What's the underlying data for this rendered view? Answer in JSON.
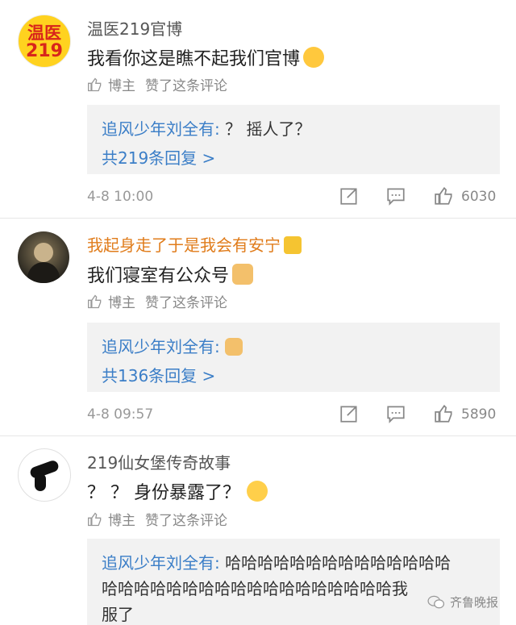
{
  "comments": [
    {
      "username": "温医219官博",
      "avatar_text_top": "温医",
      "avatar_text_bottom": "219",
      "content": "我看你这是瞧不起我们官博",
      "liked_by": "博主",
      "liked_text": "赞了这条评论",
      "reply_author": "追风少年刘全有:",
      "reply_text": " ？ 摇人了？",
      "reply_count": "共219条回复 >",
      "time": "4-8 10:00",
      "likes": "6030"
    },
    {
      "username": "我起身走了于是我会有安宁",
      "content": "我们寝室有公众号",
      "liked_by": "博主",
      "liked_text": "赞了这条评论",
      "reply_author": "追风少年刘全有:",
      "reply_text": "",
      "reply_count": "共136条回复 >",
      "time": "4-8 09:57",
      "likes": "5890"
    },
    {
      "username": "219仙女堡传奇故事",
      "content": "？ ？ 身份暴露了？",
      "liked_by": "博主",
      "liked_text": "赞了这条评论",
      "reply_author": "追风少年刘全有:",
      "reply_text": " 哈哈哈哈哈哈哈哈哈哈哈哈哈哈",
      "reply_text_2": "哈哈哈哈哈哈哈哈哈哈哈哈哈哈哈哈哈哈我",
      "reply_text_3": "服了"
    }
  ],
  "watermark": "齐鲁晚报",
  "colors": {
    "blue": "#3b7ec7",
    "orange": "#e07c1b",
    "reply_bg": "#f2f2f2"
  }
}
